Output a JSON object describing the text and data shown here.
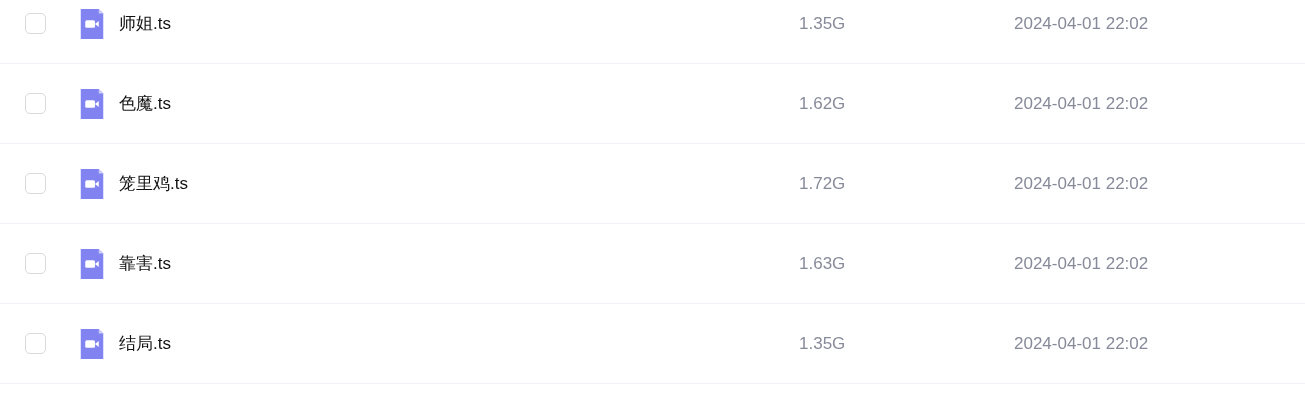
{
  "files": [
    {
      "name": "师姐.ts",
      "size": "1.35G",
      "modified": "2024-04-01 22:02",
      "checked": false
    },
    {
      "name": "色魔.ts",
      "size": "1.62G",
      "modified": "2024-04-01 22:02",
      "checked": false
    },
    {
      "name": "笼里鸡.ts",
      "size": "1.72G",
      "modified": "2024-04-01 22:02",
      "checked": false
    },
    {
      "name": "靠害.ts",
      "size": "1.63G",
      "modified": "2024-04-01 22:02",
      "checked": false
    },
    {
      "name": "结局.ts",
      "size": "1.35G",
      "modified": "2024-04-01 22:02",
      "checked": false
    }
  ]
}
